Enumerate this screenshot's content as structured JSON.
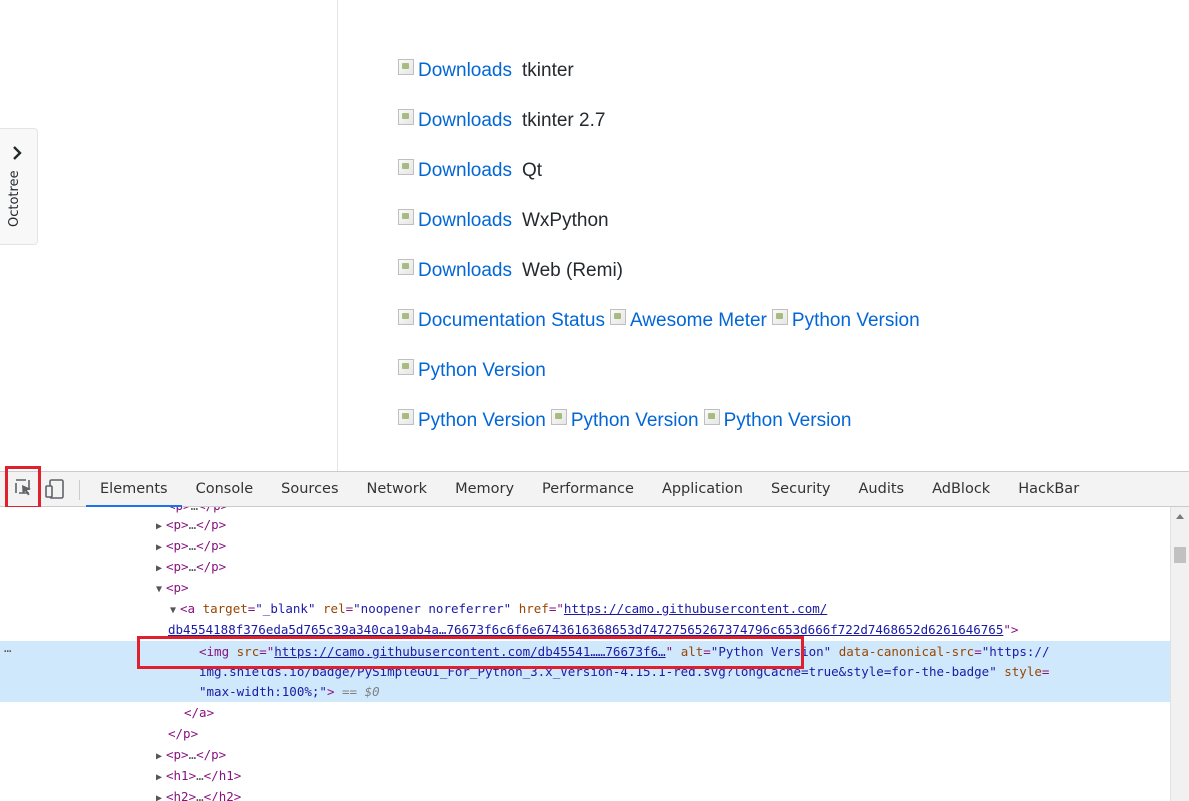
{
  "octotree": {
    "label": "Octotree"
  },
  "badges": [
    [
      {
        "alt": "Downloads",
        "after": "tkinter"
      }
    ],
    [
      {
        "alt": "Downloads",
        "after": "tkinter 2.7"
      }
    ],
    [
      {
        "alt": "Downloads",
        "after": "Qt"
      }
    ],
    [
      {
        "alt": "Downloads",
        "after": "WxPython"
      }
    ],
    [
      {
        "alt": "Downloads",
        "after": "Web (Remi)"
      }
    ],
    [
      {
        "alt": "Documentation Status",
        "after": ""
      },
      {
        "alt": "Awesome Meter",
        "after": ""
      },
      {
        "alt": "Python Version",
        "after": ""
      }
    ],
    [
      {
        "alt": "Python Version",
        "after": ""
      }
    ],
    [
      {
        "alt": "Python Version",
        "after": ""
      },
      {
        "alt": "Python Version",
        "after": ""
      },
      {
        "alt": "Python Version",
        "after": ""
      }
    ]
  ],
  "devtools": {
    "tabs": [
      "Elements",
      "Console",
      "Sources",
      "Network",
      "Memory",
      "Performance",
      "Application",
      "Security",
      "Audits",
      "AdBlock",
      "HackBar"
    ],
    "active_tab": "Elements"
  },
  "dom": {
    "p_open": "<p>",
    "p_close": "</p>",
    "a_open": "<a",
    "a_close": "</a>",
    "h1_open": "<h1>",
    "h1_close": "</h1>",
    "h2_open": "<h2>",
    "h2_close": "</h2>",
    "ellipsis": "…",
    "a_target_name": "target",
    "a_target_val": "\"_blank\"",
    "a_rel_name": "rel",
    "a_rel_val": "\"noopener noreferrer\"",
    "a_href_name": "href",
    "a_href_url1": "https://camo.githubusercontent.com/",
    "a_href_url2": "db4554188f376eda5d765c39a340ca19ab4a…76673f6c6f6e6743616368653d74727565267374796c653d666f722d7468652d6261646765",
    "img_open": "<img",
    "img_src_name": "src",
    "img_src_url": "https://camo.githubusercontent.com/db45541……76673f6…",
    "img_alt_name": "alt",
    "img_alt_val": "\"Python Version\"",
    "img_canon_name": "data-canonical-src",
    "img_canon_val1": "\"https://",
    "img_canon_val2": "img.shields.io/badge/PySimpleGUI_For_Python_3.x_Version-4.15.1-red.svg?longCache=true&style=for-the-badge\"",
    "img_style_name": "style",
    "img_style_val": "\"max-width:100%;\"",
    "img_end": ">",
    "selected_marker": "== $0",
    "row_dots": "⋯"
  }
}
